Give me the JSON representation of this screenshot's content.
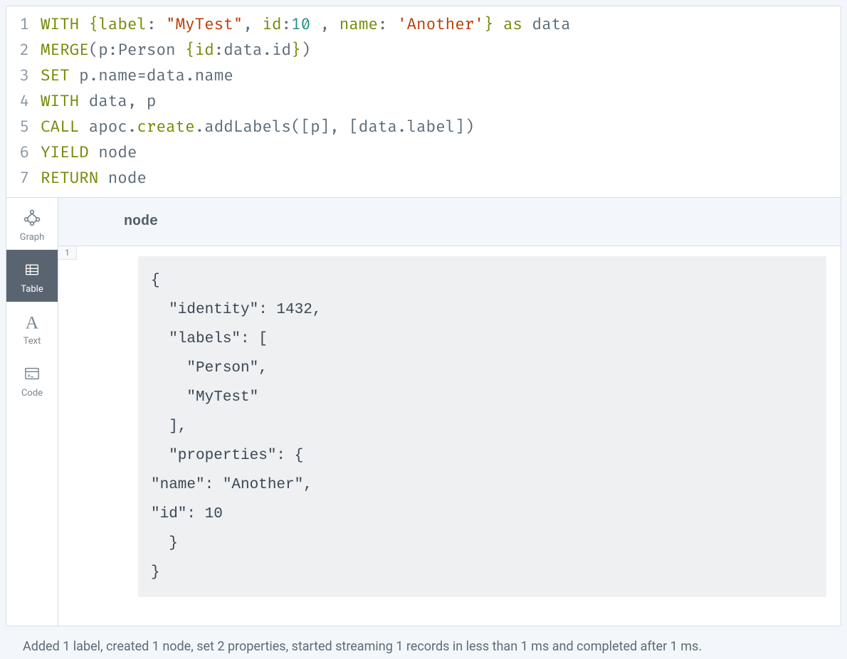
{
  "editor": {
    "lines": [
      {
        "num": "1",
        "tokens": [
          {
            "cls": "tok-keyword",
            "t": "WITH"
          },
          {
            "cls": "tok-ident",
            "t": " "
          },
          {
            "cls": "tok-brace",
            "t": "{"
          },
          {
            "cls": "tok-prop",
            "t": "label"
          },
          {
            "cls": "tok-punct",
            "t": ": "
          },
          {
            "cls": "tok-string",
            "t": "\"MyTest\""
          },
          {
            "cls": "tok-punct",
            "t": ", "
          },
          {
            "cls": "tok-prop",
            "t": "id"
          },
          {
            "cls": "tok-punct",
            "t": ":"
          },
          {
            "cls": "tok-number",
            "t": "10"
          },
          {
            "cls": "tok-punct",
            "t": " , "
          },
          {
            "cls": "tok-prop",
            "t": "name"
          },
          {
            "cls": "tok-punct",
            "t": ": "
          },
          {
            "cls": "tok-string",
            "t": "'Another'"
          },
          {
            "cls": "tok-brace",
            "t": "}"
          },
          {
            "cls": "tok-ident",
            "t": " "
          },
          {
            "cls": "tok-keyword",
            "t": "as"
          },
          {
            "cls": "tok-ident",
            "t": " data"
          }
        ]
      },
      {
        "num": "2",
        "tokens": [
          {
            "cls": "tok-keyword",
            "t": "MERGE"
          },
          {
            "cls": "tok-punct",
            "t": "("
          },
          {
            "cls": "tok-ident",
            "t": "p"
          },
          {
            "cls": "tok-punct",
            "t": ":"
          },
          {
            "cls": "tok-ident",
            "t": "Person "
          },
          {
            "cls": "tok-brace",
            "t": "{"
          },
          {
            "cls": "tok-prop",
            "t": "id"
          },
          {
            "cls": "tok-punct",
            "t": ":"
          },
          {
            "cls": "tok-ident",
            "t": "data.id"
          },
          {
            "cls": "tok-brace",
            "t": "}"
          },
          {
            "cls": "tok-punct",
            "t": ")"
          }
        ]
      },
      {
        "num": "3",
        "tokens": [
          {
            "cls": "tok-keyword",
            "t": "SET"
          },
          {
            "cls": "tok-ident",
            "t": " p.name=data.name"
          }
        ]
      },
      {
        "num": "4",
        "tokens": [
          {
            "cls": "tok-keyword",
            "t": "WITH"
          },
          {
            "cls": "tok-ident",
            "t": " data, p"
          }
        ]
      },
      {
        "num": "5",
        "tokens": [
          {
            "cls": "tok-keyword",
            "t": "CALL"
          },
          {
            "cls": "tok-ident",
            "t": " apoc."
          },
          {
            "cls": "tok-keyword",
            "t": "create"
          },
          {
            "cls": "tok-ident",
            "t": ".addLabels([p], [data.label])"
          }
        ]
      },
      {
        "num": "6",
        "tokens": [
          {
            "cls": "tok-keyword",
            "t": "YIELD"
          },
          {
            "cls": "tok-ident",
            "t": " node"
          }
        ]
      },
      {
        "num": "7",
        "tokens": [
          {
            "cls": "tok-keyword",
            "t": "RETURN"
          },
          {
            "cls": "tok-ident",
            "t": " node"
          }
        ]
      }
    ]
  },
  "sidebar": {
    "tabs": [
      {
        "id": "graph",
        "label": "Graph",
        "icon": "graph-icon",
        "active": false
      },
      {
        "id": "table",
        "label": "Table",
        "icon": "table-icon",
        "active": true
      },
      {
        "id": "text",
        "label": "Text",
        "icon": "text-icon",
        "active": false
      },
      {
        "id": "code",
        "label": "Code",
        "icon": "code-icon",
        "active": false
      }
    ]
  },
  "results": {
    "column_header": "node",
    "row_number": "1",
    "json_lines": [
      "{",
      "  \"identity\": 1432,",
      "  \"labels\": [",
      "    \"Person\",",
      "    \"MyTest\"",
      "  ],",
      "  \"properties\": {",
      "\"name\": \"Another\",",
      "\"id\": 10",
      "  }",
      "}"
    ]
  },
  "status": {
    "message": "Added 1 label, created 1 node, set 2 properties, started streaming 1 records in less than 1 ms and completed after 1 ms."
  }
}
